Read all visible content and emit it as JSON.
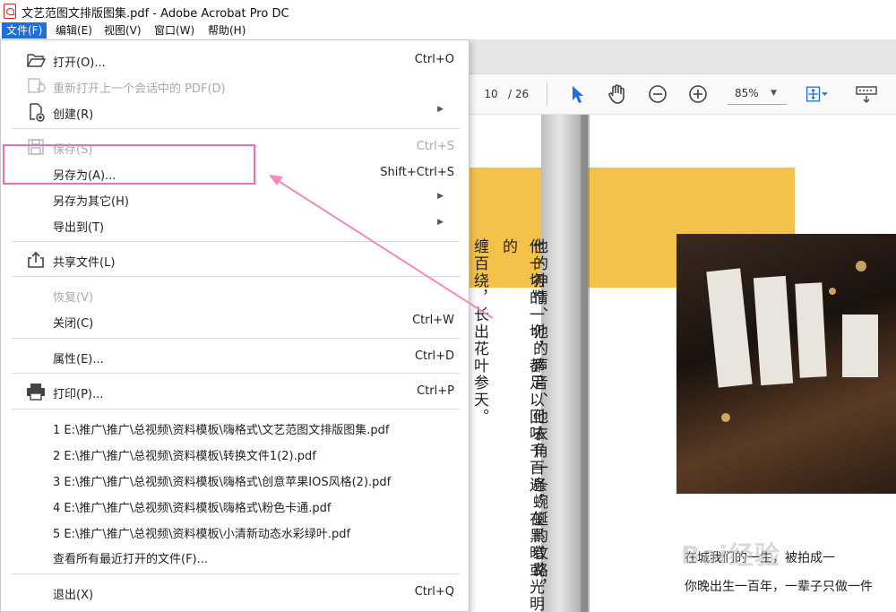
{
  "window": {
    "title": "文艺范图文排版图集.pdf - Adobe Acrobat Pro DC"
  },
  "menubar": {
    "items": [
      "文件(F)",
      "编辑(E)",
      "视图(V)",
      "窗口(W)",
      "帮助(H)"
    ]
  },
  "file_menu": {
    "items": [
      {
        "label": "打开(O)...",
        "shortcut": "Ctrl+O",
        "icon": "folder-open-icon",
        "enabled": true
      },
      {
        "label": "重新打开上一个会话中的 PDF(D)",
        "shortcut": "",
        "icon": "reopen-icon",
        "enabled": false
      },
      {
        "label": "创建(R)",
        "shortcut": "",
        "icon": "create-pdf-icon",
        "enabled": true,
        "submenu": true
      },
      {
        "label": "保存(S)",
        "shortcut": "Ctrl+S",
        "icon": "save-icon",
        "enabled": false
      },
      {
        "label": "另存为(A)...",
        "shortcut": "Shift+Ctrl+S",
        "icon": "",
        "enabled": true
      },
      {
        "label": "另存为其它(H)",
        "shortcut": "",
        "icon": "",
        "enabled": true,
        "submenu": true
      },
      {
        "label": "导出到(T)",
        "shortcut": "",
        "icon": "",
        "enabled": true,
        "submenu": true
      },
      {
        "label": "共享文件(L)",
        "shortcut": "",
        "icon": "share-icon",
        "enabled": true
      },
      {
        "label": "恢复(V)",
        "shortcut": "",
        "icon": "",
        "enabled": false
      },
      {
        "label": "关闭(C)",
        "shortcut": "Ctrl+W",
        "icon": "",
        "enabled": true
      },
      {
        "label": "属性(E)...",
        "shortcut": "Ctrl+D",
        "icon": "",
        "enabled": true
      },
      {
        "label": "打印(P)...",
        "shortcut": "Ctrl+P",
        "icon": "printer-icon",
        "enabled": true
      },
      {
        "label": "1 E:\\推广\\推广\\总视频\\资料模板\\嗨格式\\文艺范图文排版图集.pdf",
        "shortcut": "",
        "icon": "",
        "enabled": true
      },
      {
        "label": "2 E:\\推广\\推广\\总视频\\资料模板\\转换文件1(2).pdf",
        "shortcut": "",
        "icon": "",
        "enabled": true
      },
      {
        "label": "3 E:\\推广\\推广\\总视频\\资料模板\\嗨格式\\创意苹果IOS风格(2).pdf",
        "shortcut": "",
        "icon": "",
        "enabled": true
      },
      {
        "label": "4 E:\\推广\\推广\\总视频\\资料模板\\嗨格式\\粉色卡通.pdf",
        "shortcut": "",
        "icon": "",
        "enabled": true
      },
      {
        "label": "5 E:\\推广\\推广\\总视频\\资料模板\\小清新动态水彩绿叶.pdf",
        "shortcut": "",
        "icon": "",
        "enabled": true
      },
      {
        "label": "查看所有最近打开的文件(F)...",
        "shortcut": "",
        "icon": "",
        "enabled": true
      },
      {
        "label": "退出(X)",
        "shortcut": "Ctrl+Q",
        "icon": "",
        "enabled": true
      }
    ]
  },
  "toolbar": {
    "page_current": "10",
    "page_total": "/ 26",
    "zoom": "85%",
    "icons": [
      "select-arrow-icon",
      "hand-tool-icon",
      "zoom-out-icon",
      "zoom-in-icon",
      "fit-page-icon",
      "keyboard-icon"
    ]
  },
  "document": {
    "vertical_text": [
      "他的神情、他的声音、他衣角一条蜿蜒的纹路，",
      "他一切的一切，都足以回味千百遍，在黑暗或光明的",
      "缠百绕，长出花叶参天。"
    ],
    "body_lines": [
      "在城我们的一生，被拍成一",
      "你晚出生一百年，一辈子只做一件"
    ],
    "watermark": "Bai经验"
  },
  "colors": {
    "accent": "#1e6fd9",
    "highlight": "#ef6fb0",
    "yellow_block": "#f4c24b",
    "arrow": "#f28ac0"
  }
}
